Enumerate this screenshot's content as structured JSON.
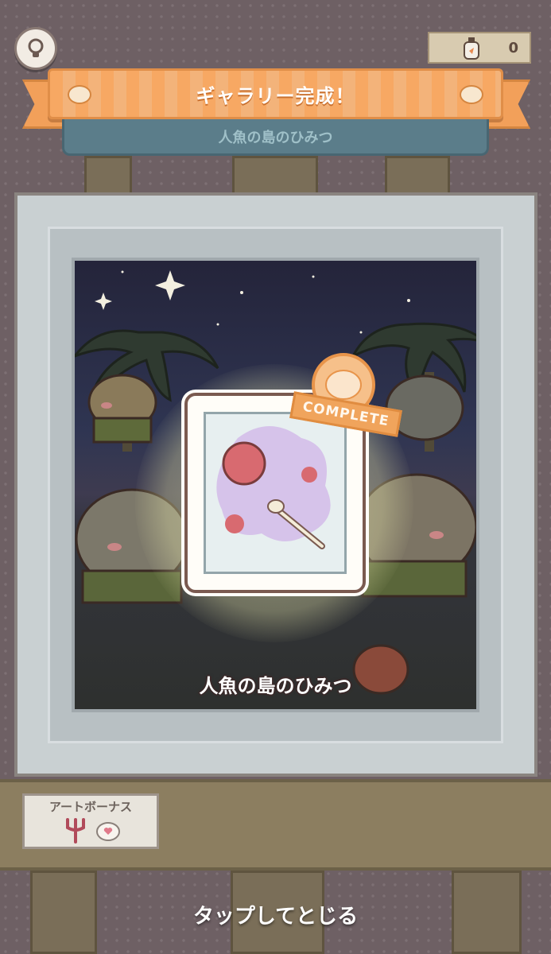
{
  "header": {
    "counter_value": "0",
    "hint_icon": "lightbulb-icon",
    "counter_icon": "bottle-icon"
  },
  "banner": {
    "title": "ギャラリー完成！",
    "subtitle": "人魚の島のひみつ"
  },
  "painting": {
    "title": "人魚の島のひみつ",
    "stamp_text": "COMPLETE"
  },
  "bonus": {
    "label": "アートボーナス",
    "icons": [
      "trident-icon",
      "heart-bear-icon"
    ]
  },
  "footer": {
    "close_text": "タップしてとじる"
  },
  "colors": {
    "ribbon": "#f7a863",
    "sub_banner": "#5b7d8a",
    "stamp": "#f0a45c",
    "easel_wood": "#7a6e58"
  }
}
